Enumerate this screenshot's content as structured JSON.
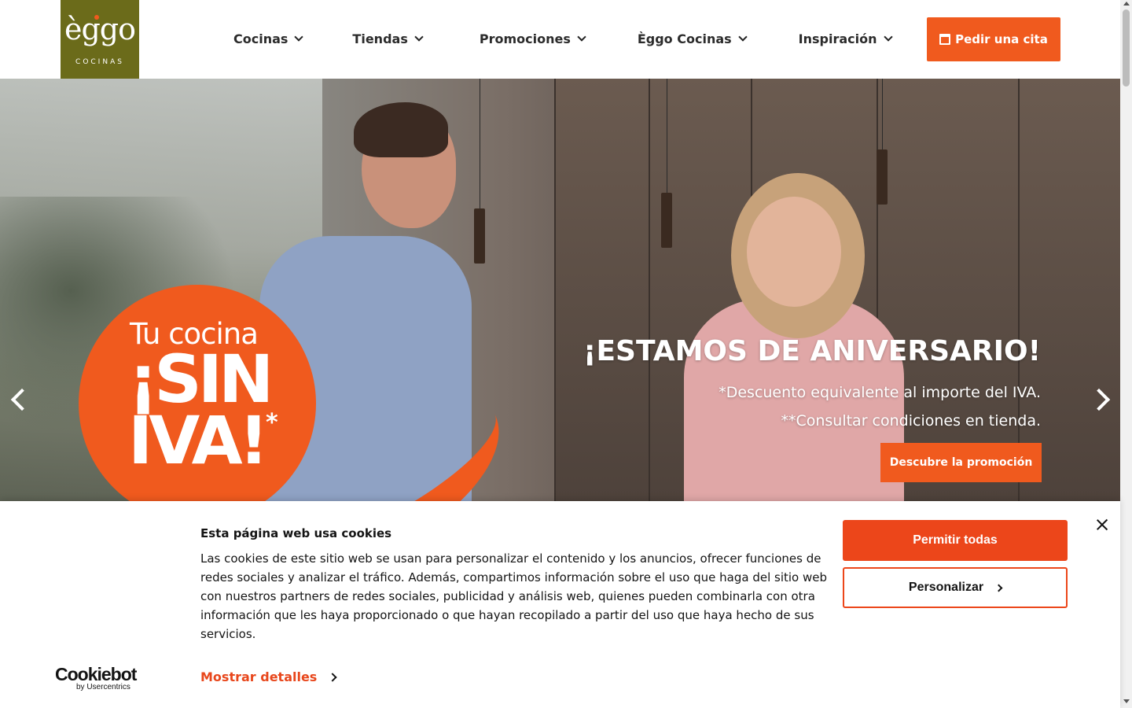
{
  "header": {
    "logo_word": "èggo",
    "logo_sub": "COCINAS",
    "nav": [
      {
        "label": "Cocinas"
      },
      {
        "label": "Tiendas"
      },
      {
        "label": "Promociones"
      },
      {
        "label": "Èggo Cocinas"
      },
      {
        "label": "Inspiración"
      }
    ],
    "cta_label": "Pedir una cita",
    "icons": {
      "cta": "calendar-icon",
      "nav": "chevron-down-icon"
    }
  },
  "hero": {
    "badge_line1": "Tu cocina",
    "badge_line2": "¡SIN",
    "badge_line3": "IVA!",
    "badge_star": "*",
    "title": "¡ESTAMOS DE ANIVERSARIO!",
    "note1": "*Descuento equivalente al importe del IVA.",
    "note2": "**Consultar condiciones en tienda.",
    "button_label": "Descubre la promoción",
    "icons": {
      "prev": "chevron-left-icon",
      "next": "chevron-right-icon"
    }
  },
  "cookie_banner": {
    "title": "Esta página web usa cookies",
    "text": "Las cookies de este sitio web se usan para personalizar el contenido y los anuncios, ofrecer funciones de redes sociales y analizar el tráfico. Además, compartimos información sobre el uso que haga del sitio web con nuestros partners de redes sociales, publicidad y análisis web, quienes pueden combinarla con otra información que les haya proporcionado o que hayan recopilado a partir del uso que haya hecho de sus servicios.",
    "details_label": "Mostrar detalles",
    "allow_label": "Permitir todas",
    "customize_label": "Personalizar",
    "brand_main": "Cookiebot",
    "brand_sub": "by Usercentrics"
  },
  "colors": {
    "accent": "#f05a1e",
    "logo_bg": "#6b6b1a",
    "cookie_accent": "#ec461a"
  }
}
